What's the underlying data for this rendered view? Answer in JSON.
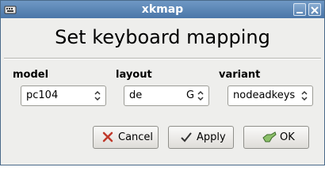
{
  "window": {
    "title": "xkmap"
  },
  "dialog": {
    "heading": "Set keyboard mapping"
  },
  "fields": {
    "model": {
      "label": "model",
      "value": "pc104"
    },
    "layout": {
      "label": "layout",
      "value": "de",
      "value_suffix": "G"
    },
    "variant": {
      "label": "variant",
      "value": "nodeadkeys"
    }
  },
  "buttons": {
    "cancel": "Cancel",
    "apply": "Apply",
    "ok": "OK"
  },
  "icons": {
    "app": "keyboard-icon",
    "minimize": "minimize-icon",
    "close": "close-icon",
    "combo_arrows": "updown-chevron-icon",
    "cancel": "x-icon",
    "apply": "checkmark-icon",
    "ok": "ok-hand-icon"
  },
  "colors": {
    "titlebar": "#4a76a8",
    "window_bg": "#eeeeec",
    "cancel_icon": "#c0392b",
    "ok_icon": "#6aa84f"
  }
}
